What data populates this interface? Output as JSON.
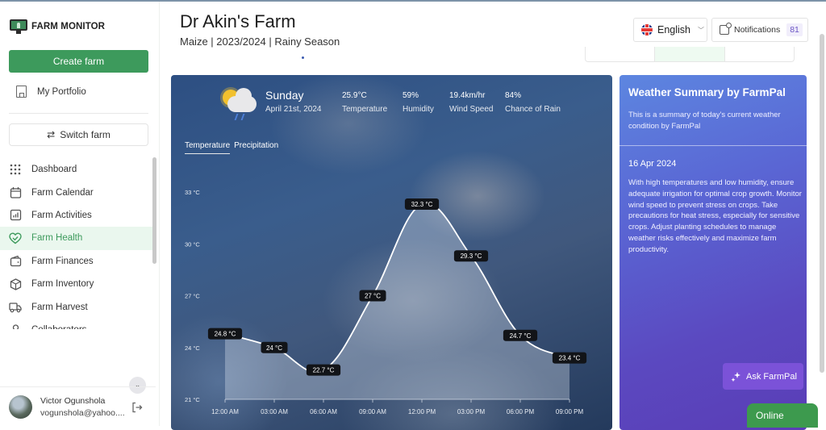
{
  "app": {
    "name": "FARM MONITOR"
  },
  "sidebar": {
    "create_label": "Create farm",
    "portfolio_label": "My Portfolio",
    "switch_label": "Switch farm",
    "items": [
      {
        "label": "Dashboard",
        "icon": "grid-icon",
        "active": false
      },
      {
        "label": "Farm Calendar",
        "icon": "calendar-icon",
        "active": false
      },
      {
        "label": "Farm Activities",
        "icon": "chart-bar-icon",
        "active": false
      },
      {
        "label": "Farm Health",
        "icon": "heart-icon",
        "active": true
      },
      {
        "label": "Farm Finances",
        "icon": "wallet-icon",
        "active": false
      },
      {
        "label": "Farm Inventory",
        "icon": "box-icon",
        "active": false
      },
      {
        "label": "Farm Harvest",
        "icon": "truck-icon",
        "active": false
      },
      {
        "label": "Collaborators",
        "icon": "users-icon",
        "active": false
      }
    ],
    "user": {
      "name": "Victor Ogunshola",
      "email": "vogunshola@yahoo...."
    }
  },
  "header": {
    "title": "Dr Akin's Farm",
    "subtitle": "Maize | 2023/2024 | Rainy Season",
    "language": "English",
    "notifications_label": "Notifications",
    "notifications_count": "81"
  },
  "weather": {
    "day": "Sunday",
    "date": "April 21st, 2024",
    "stats": [
      {
        "value": "25.9°C",
        "label": "Temperature"
      },
      {
        "value": "59%",
        "label": "Humidity"
      },
      {
        "value": "19.4km/hr",
        "label": "Wind Speed"
      },
      {
        "value": "84%",
        "label": "Chance of Rain"
      }
    ],
    "tabs": [
      {
        "label": "Temperature",
        "active": true
      },
      {
        "label": "Precipitation",
        "active": false
      }
    ]
  },
  "chart_data": {
    "type": "area",
    "title": "",
    "xlabel": "",
    "ylabel": "",
    "categories": [
      "12:00 AM",
      "03:00 AM",
      "06:00 AM",
      "09:00 AM",
      "12:00 PM",
      "03:00 PM",
      "06:00 PM",
      "09:00 PM"
    ],
    "series": [
      {
        "name": "Temperature",
        "values": [
          24.8,
          24,
          22.7,
          27,
          32.3,
          29.3,
          24.7,
          23.4
        ]
      }
    ],
    "data_labels": [
      "24.8 °C",
      "24 °C",
      "22.7 °C",
      "27 °C",
      "32.3 °C",
      "29.3 °C",
      "24.7 °C",
      "23.4 °C"
    ],
    "y_ticks": [
      21,
      24,
      27,
      30,
      33
    ],
    "y_tick_labels": [
      "21 °C",
      "24 °C",
      "27 °C",
      "30 °C",
      "33 °C"
    ],
    "ylim": [
      21,
      33
    ],
    "grid": false,
    "legend": "none"
  },
  "summary": {
    "title": "Weather Summary by FarmPal",
    "description": "This is a summary of today's current weather condition by FarmPal",
    "date": "16 Apr 2024",
    "body": "With high temperatures and low humidity, ensure adequate irrigation for optimal crop growth. Monitor wind speed to prevent stress on crops. Take precautions for heat stress, especially for sensitive crops. Adjust planting schedules to manage weather risks effectively and maximize farm productivity.",
    "ask_label": "Ask FarmPal"
  },
  "status": {
    "online_label": "Online"
  }
}
